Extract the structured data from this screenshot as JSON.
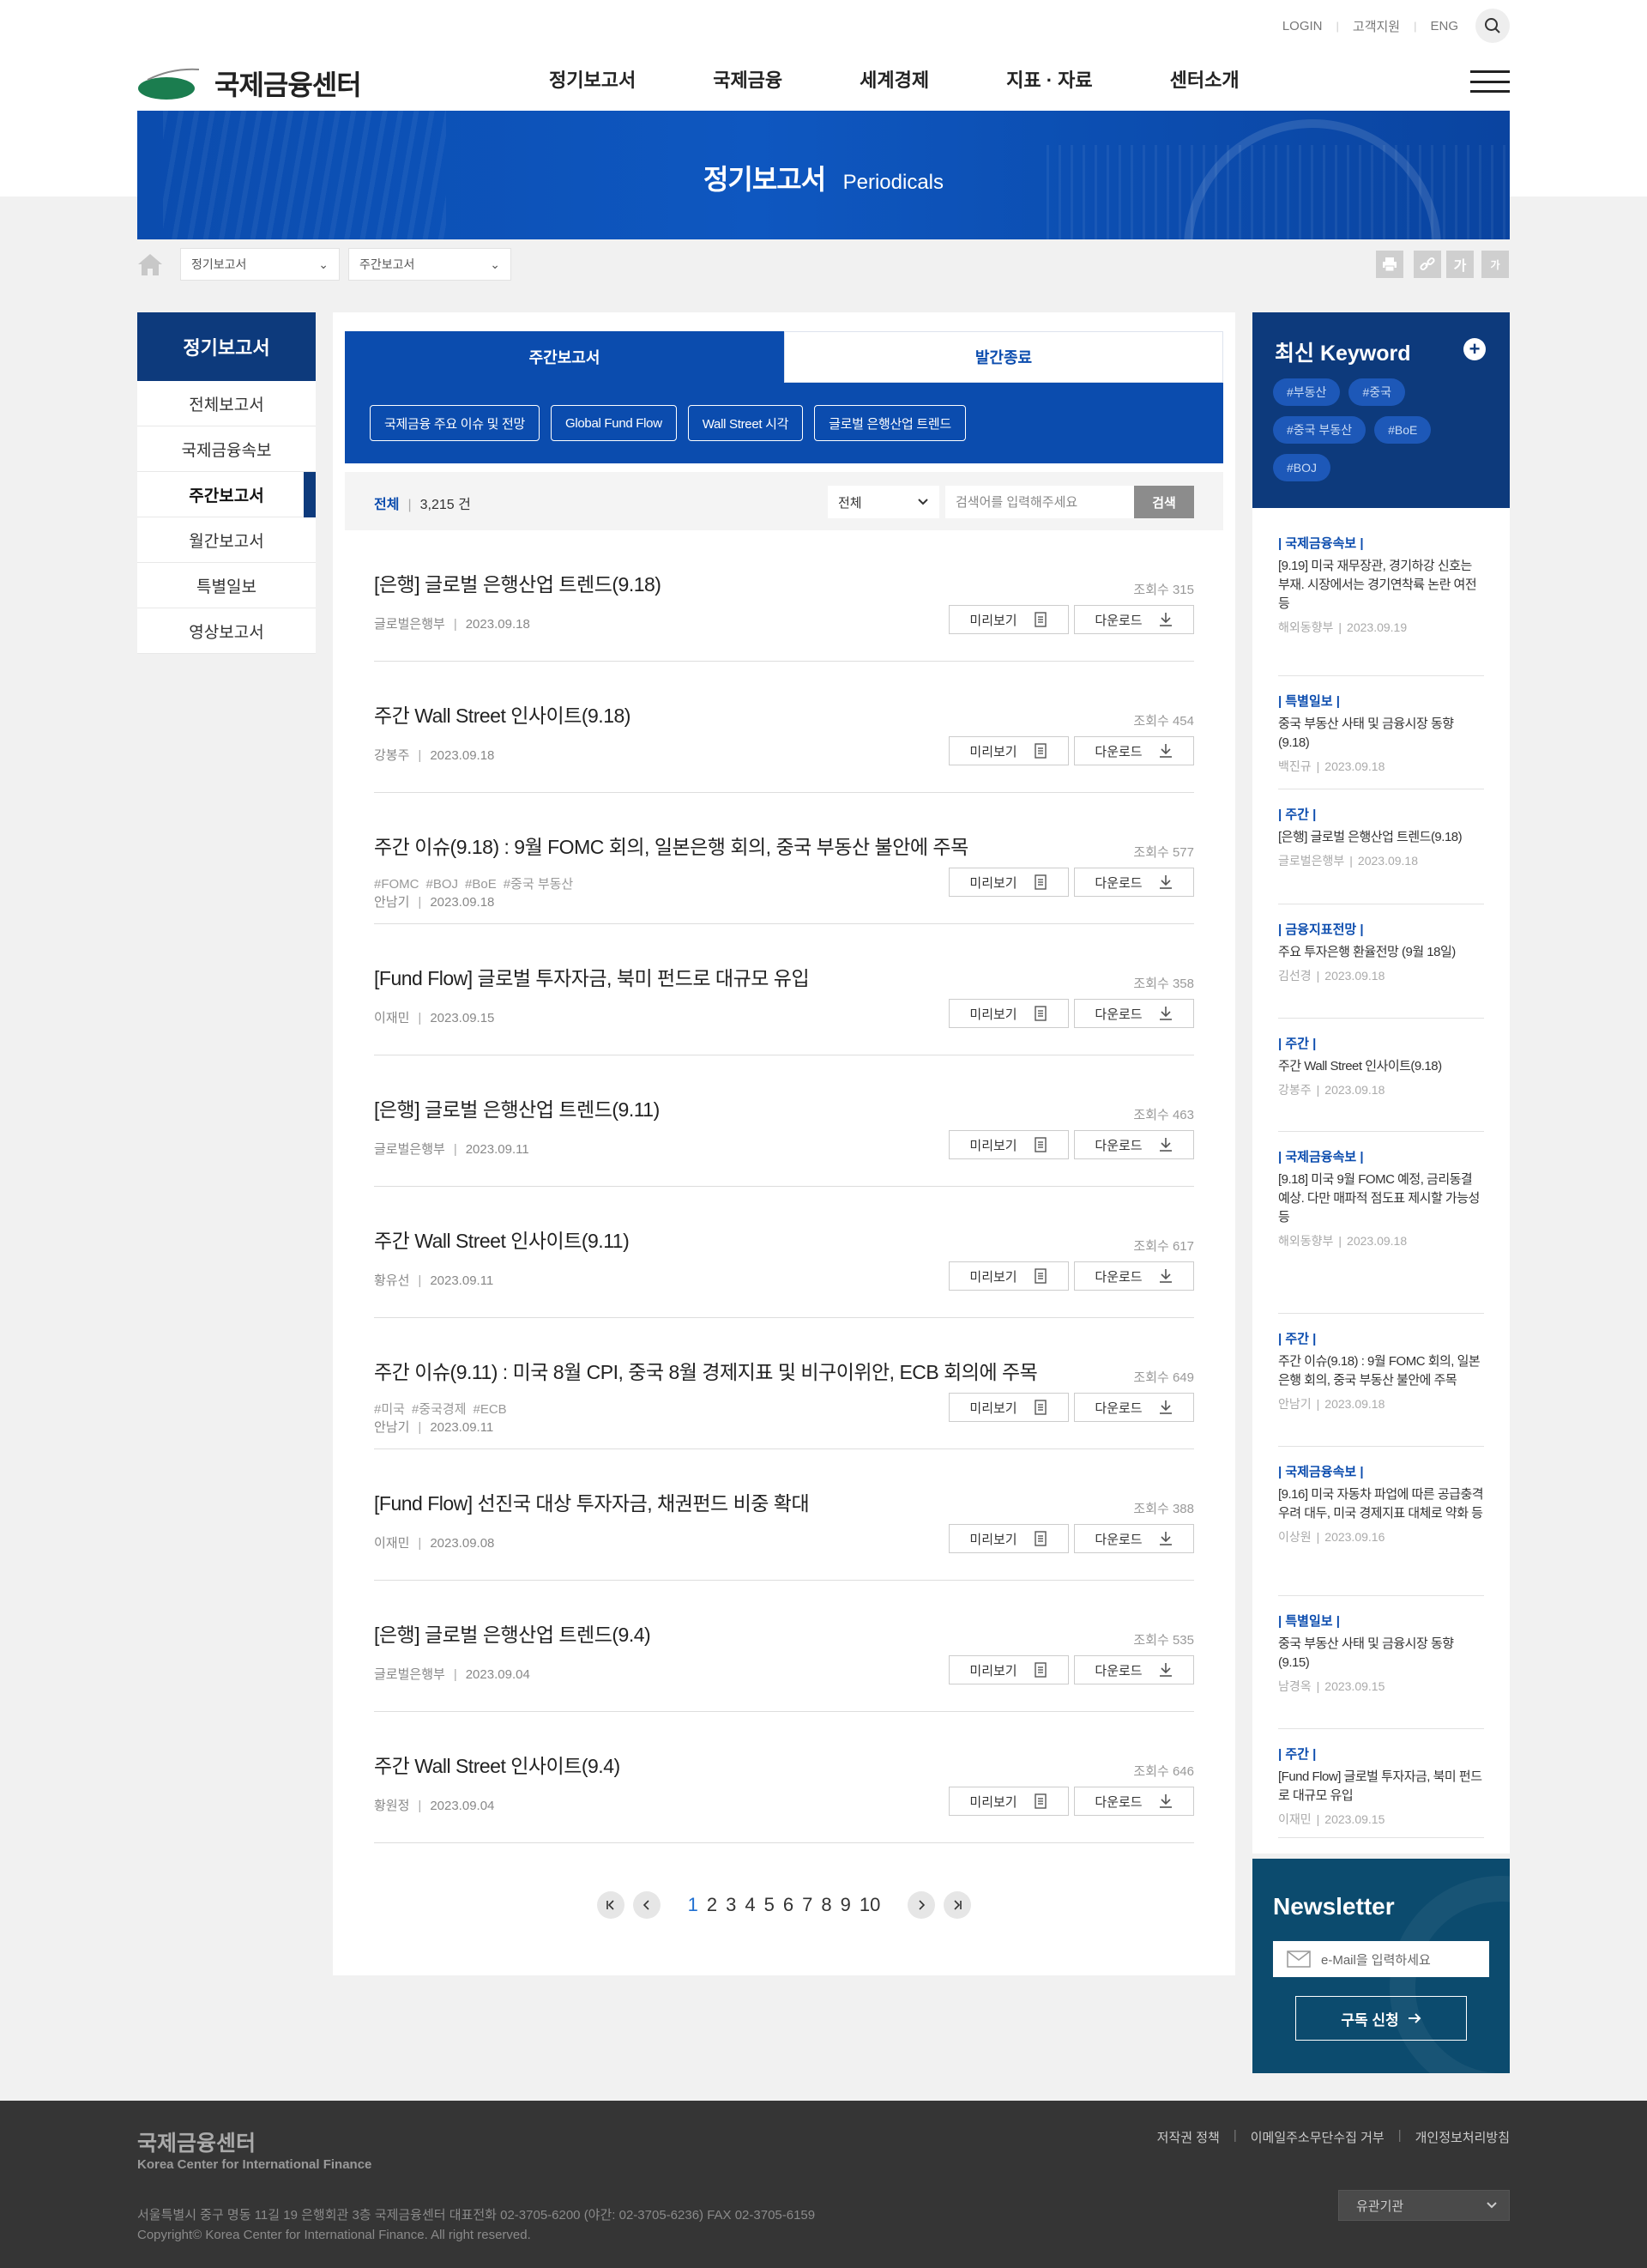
{
  "util": {
    "login": "LOGIN",
    "support": "고객지원",
    "eng": "ENG"
  },
  "logo": {
    "name": "국제금융센터"
  },
  "gnb": [
    "정기보고서",
    "국제금융",
    "세계경제",
    "지표 · 자료",
    "센터소개"
  ],
  "hero": {
    "title_ko": "정기보고서",
    "title_en": "Periodicals"
  },
  "breadcrumb": {
    "select1": "정기보고서",
    "select2": "주간보고서"
  },
  "tools": {
    "font_up": "가",
    "font_down": "가"
  },
  "lnb": {
    "title": "정기보고서",
    "items": [
      "전체보고서",
      "국제금융속보",
      "주간보고서",
      "월간보고서",
      "특별일보",
      "영상보고서"
    ],
    "active_index": 2
  },
  "tabs": [
    "주간보고서",
    "발간종료"
  ],
  "chips": [
    "국제금융 주요 이슈 및 전망",
    "Global Fund Flow",
    "Wall Street 시각",
    "글로벌 은행산업 트렌드"
  ],
  "search": {
    "total_label": "전체",
    "total_count": "3,215 건",
    "filter": "전체",
    "placeholder": "검색어를 입력해주세요",
    "button": "검색"
  },
  "buttons": {
    "preview": "미리보기",
    "download": "다운로드"
  },
  "reports": [
    {
      "title": "[은행] 글로벌 은행산업 트렌드(9.18)",
      "views": "조회수 315",
      "tags": [],
      "author": "글로벌은행부",
      "date": "2023.09.18"
    },
    {
      "title": "주간 Wall Street 인사이트(9.18)",
      "views": "조회수 454",
      "tags": [],
      "author": "강봉주",
      "date": "2023.09.18"
    },
    {
      "title": "주간 이슈(9.18) : 9월 FOMC 회의, 일본은행 회의, 중국 부동산 불안에 주목",
      "views": "조회수 577",
      "tags": [
        "#FOMC",
        "#BOJ",
        "#BoE",
        "#중국 부동산"
      ],
      "author": "안남기",
      "date": "2023.09.18"
    },
    {
      "title": "[Fund Flow] 글로벌 투자자금, 북미 펀드로 대규모 유입",
      "views": "조회수 358",
      "tags": [],
      "author": "이재민",
      "date": "2023.09.15"
    },
    {
      "title": "[은행] 글로벌 은행산업 트렌드(9.11)",
      "views": "조회수 463",
      "tags": [],
      "author": "글로벌은행부",
      "date": "2023.09.11"
    },
    {
      "title": "주간 Wall Street 인사이트(9.11)",
      "views": "조회수 617",
      "tags": [],
      "author": "황유선",
      "date": "2023.09.11"
    },
    {
      "title": "주간 이슈(9.11) : 미국 8월 CPI, 중국 8월 경제지표 및 비구이위안, ECB 회의에 주목",
      "views": "조회수 649",
      "tags": [
        "#미국",
        "#중국경제",
        "#ECB"
      ],
      "author": "안남기",
      "date": "2023.09.11"
    },
    {
      "title": "[Fund Flow] 선진국 대상 투자자금, 채권펀드 비중 확대",
      "views": "조회수 388",
      "tags": [],
      "author": "이재민",
      "date": "2023.09.08"
    },
    {
      "title": "[은행] 글로벌 은행산업 트렌드(9.4)",
      "views": "조회수 535",
      "tags": [],
      "author": "글로벌은행부",
      "date": "2023.09.04"
    },
    {
      "title": "주간 Wall Street 인사이트(9.4)",
      "views": "조회수 646",
      "tags": [],
      "author": "황원정",
      "date": "2023.09.04"
    }
  ],
  "pagination": {
    "pages": [
      "1",
      "2",
      "3",
      "4",
      "5",
      "6",
      "7",
      "8",
      "9",
      "10"
    ],
    "current": "1"
  },
  "keyword": {
    "title": "최신 Keyword",
    "tags": [
      "#부동산",
      "#중국",
      "#중국 부동산",
      "#BoE",
      "#BOJ"
    ]
  },
  "feed": [
    {
      "cat": "| 국제금융속보 |",
      "title": "[9.19] 미국 재무장관, 경기하강 신호는 부재. 시장에서는 경기연착륙 논란 여전 등",
      "author": "해외동향부",
      "date": "2023.09.19"
    },
    {
      "cat": "| 특별일보 |",
      "title": "중국 부동산 사태 및 금융시장 동향 (9.18)",
      "author": "백진규",
      "date": "2023.09.18"
    },
    {
      "cat": "| 주간 |",
      "title": "[은행] 글로벌 은행산업 트렌드(9.18)",
      "author": "글로벌은행부",
      "date": "2023.09.18"
    },
    {
      "cat": "| 금융지표전망 |",
      "title": "주요 투자은행 환율전망 (9월 18일)",
      "author": "김선경",
      "date": "2023.09.18"
    },
    {
      "cat": "| 주간 |",
      "title": "주간 Wall Street 인사이트(9.18)",
      "author": "강봉주",
      "date": "2023.09.18"
    },
    {
      "cat": "| 국제금융속보 |",
      "title": "[9.18] 미국 9월 FOMC 예정, 금리동결 예상. 다만 매파적 점도표 제시할 가능성 등",
      "author": "해외동향부",
      "date": "2023.09.18"
    },
    {
      "cat": "| 주간 |",
      "title": "주간 이슈(9.18) : 9월 FOMC 회의, 일본은행 회의, 중국 부동산 불안에 주목",
      "author": "안남기",
      "date": "2023.09.18"
    },
    {
      "cat": "| 국제금융속보 |",
      "title": "[9.16] 미국 자동차 파업에 따른 공급충격 우려 대두, 미국 경제지표 대체로 약화 등",
      "author": "이상원",
      "date": "2023.09.16"
    },
    {
      "cat": "| 특별일보 |",
      "title": "중국 부동산 사태 및 금융시장 동향 (9.15)",
      "author": "남경옥",
      "date": "2023.09.15"
    },
    {
      "cat": "| 주간 |",
      "title": "[Fund Flow] 글로벌 투자자금, 북미 펀드로 대규모 유입",
      "author": "이재민",
      "date": "2023.09.15"
    }
  ],
  "newsletter": {
    "title": "Newsletter",
    "placeholder": "e-Mail을 입력하세요",
    "button": "구독 신청"
  },
  "footer": {
    "name": "국제금융센터",
    "name_en": "Korea Center for International Finance",
    "address": "서울특별시 중구 명동 11길 19 은행회관 3층 국제금융센터 대표전화 02-3705-6200 (야간: 02-3705-6236) FAX 02-3705-6159",
    "copyright": "Copyright© Korea Center for International Finance. All right reserved.",
    "links": [
      "저작권 정책",
      "이메일주소무단수집 거부",
      "개인정보처리방침"
    ],
    "related": "유관기관"
  },
  "colors": {
    "primary": "#0b4cae",
    "navy": "#0d3a7c",
    "newsletter_bg": "#0c4b6e",
    "footer_bg": "#353535"
  }
}
